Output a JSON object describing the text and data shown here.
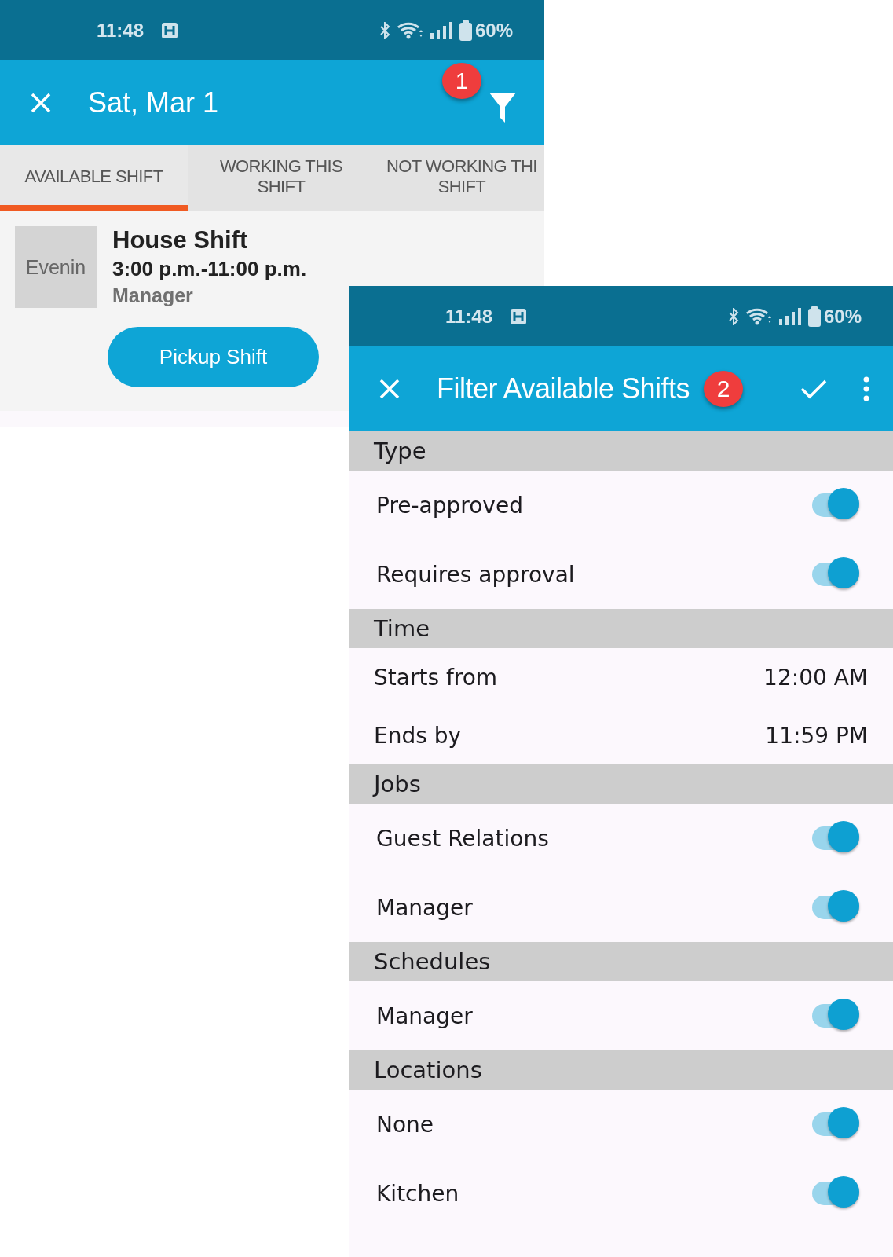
{
  "shifts_screen": {
    "status_bar": {
      "time": "11:48",
      "battery": "60%"
    },
    "app_bar": {
      "title": "Sat, Mar 1",
      "badge": "1"
    },
    "tabs": [
      {
        "label": "AVAILABLE SHIFT",
        "selected": true
      },
      {
        "label": "WORKING THIS\nSHIFT",
        "selected": false
      },
      {
        "label": "NOT WORKING THI\nSHIFT",
        "selected": false
      }
    ],
    "shift_card": {
      "thumbnail": "Evenin",
      "title": "House Shift",
      "time": "3:00 p.m.-11:00 p.m.",
      "job": "Manager",
      "button": "Pickup Shift"
    }
  },
  "filter_screen": {
    "status_bar": {
      "time": "11:48",
      "battery": "60%"
    },
    "app_bar": {
      "title": "Filter Available Shifts",
      "badge": "2"
    },
    "sections": [
      {
        "header": "Type",
        "rows": [
          {
            "kind": "toggle",
            "label": "Pre-approved",
            "on": true
          },
          {
            "kind": "toggle",
            "label": "Requires approval",
            "on": true
          }
        ]
      },
      {
        "header": "Time",
        "rows": [
          {
            "kind": "value",
            "label": "Starts from",
            "value": "12:00 AM"
          },
          {
            "kind": "value",
            "label": "Ends by",
            "value": "11:59 PM"
          }
        ]
      },
      {
        "header": "Jobs",
        "rows": [
          {
            "kind": "toggle",
            "label": "Guest Relations",
            "on": true
          },
          {
            "kind": "toggle",
            "label": "Manager",
            "on": true
          }
        ]
      },
      {
        "header": "Schedules",
        "rows": [
          {
            "kind": "toggle",
            "label": "Manager",
            "on": true
          }
        ]
      },
      {
        "header": "Locations",
        "rows": [
          {
            "kind": "toggle",
            "label": "None",
            "on": true
          },
          {
            "kind": "toggle",
            "label": "Kitchen",
            "on": true
          }
        ]
      }
    ]
  }
}
